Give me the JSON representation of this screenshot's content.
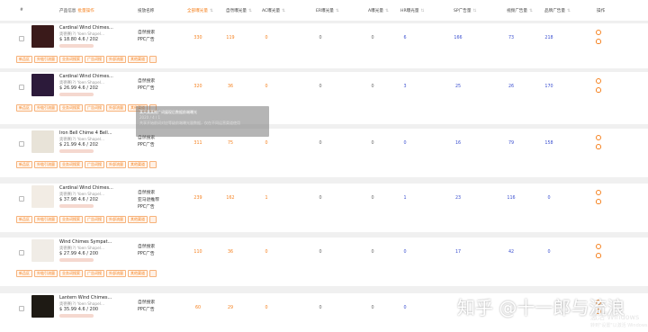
{
  "header": {
    "hash": "#",
    "product": "产品信息",
    "product_link": "批量操作",
    "campaign": "投放名称",
    "c1": "全部曝光量",
    "c2": "自然曝光量",
    "c3": "AC曝光量",
    "c4": "ER曝光量",
    "c5": "A曝光量",
    "c6": "HR曝光量",
    "c7": "SP广告量",
    "c8": "视频广告量",
    "c9": "品牌广告量",
    "ops": "操作"
  },
  "tags": [
    "新品区",
    "外链引流量",
    "业务词搜索",
    "广告词搜",
    "外部流量",
    "其他渠道"
  ],
  "rows": [
    {
      "name": "Cardinal Wind Chimes...",
      "meta": "奥德赛(?)   Yoen Shapel...",
      "price": "$ 18.80",
      "rating": "4.6",
      "reviews": "202",
      "camp": [
        "自然搜索",
        "PPC广告"
      ],
      "vals": [
        "330",
        "119",
        "0",
        "0",
        "0",
        "6",
        "166",
        "73",
        "218"
      ],
      "thumb": "#3a1a1a"
    },
    {
      "name": "Cardinal Wind Chimes...",
      "meta": "奥德赛(?)   Yoen Shapel...",
      "price": "$ 26.99",
      "rating": "4.6",
      "reviews": "202",
      "camp": [
        "自然搜索",
        "PPC广告"
      ],
      "vals": [
        "320",
        "36",
        "0",
        "0",
        "0",
        "3",
        "25",
        "26",
        "170"
      ],
      "thumb": "#2c1a3a"
    },
    {
      "name": "Iron Bell Chime 4 Bell...",
      "meta": "奥德赛(?)   Yoen Shapel...",
      "price": "$ 21.99",
      "rating": "4.6",
      "reviews": "202",
      "camp": [
        "自然搜索",
        "PPC广告"
      ],
      "vals": [
        "311",
        "75",
        "0",
        "0",
        "0",
        "0",
        "16",
        "79",
        "158"
      ],
      "thumb": "#e8e3d8"
    },
    {
      "name": "Cardinal Wind Chimes...",
      "meta": "奥德赛(?)   Yoen Shapel...",
      "price": "$ 37.98",
      "rating": "4.6",
      "reviews": "202",
      "camp": [
        "自然搜索",
        "亚马逊推荐",
        "PPC广告"
      ],
      "vals": [
        "239",
        "162",
        "1",
        "0",
        "0",
        "1",
        "23",
        "116",
        "0"
      ],
      "thumb": "#f2ece4"
    },
    {
      "name": "Wind Chimes Sympat...",
      "meta": "奥德赛(?)   Yoen Shapel...",
      "price": "$ 27.99",
      "rating": "4.6",
      "reviews": "200",
      "camp": [
        "自然搜索",
        "PPC广告"
      ],
      "vals": [
        "110",
        "36",
        "0",
        "0",
        "0",
        "0",
        "17",
        "42",
        "0"
      ],
      "thumb": "#f0ece6"
    },
    {
      "name": "Lantern Wind Chimes...",
      "meta": "奥德赛(?)   Yoen Shapel...",
      "price": "$ 35.99",
      "rating": "4.6",
      "reviews": "200",
      "camp": [
        "自然搜索",
        "PPC广告"
      ],
      "vals": [
        "60",
        "29",
        "0",
        "0",
        "0",
        "0",
        "",
        "",
        ""
      ],
      "thumb": "#1e1a14"
    }
  ],
  "tooltip": {
    "line1": "某天某某推广词展现后数据前端曝光",
    "line2": "2020 / 4 / 1",
    "line3": "共享开始前词对应等级前端曝光量数据，仅在不同运营渠道使用"
  },
  "watermark": "知乎 @十一郎与流浪",
  "windows": {
    "line1": "激活 Windows",
    "line2": "转到\"设置\"以激活 Windows"
  },
  "colors": {
    "accent": "#f58220",
    "blue": "#3a4fd0"
  }
}
